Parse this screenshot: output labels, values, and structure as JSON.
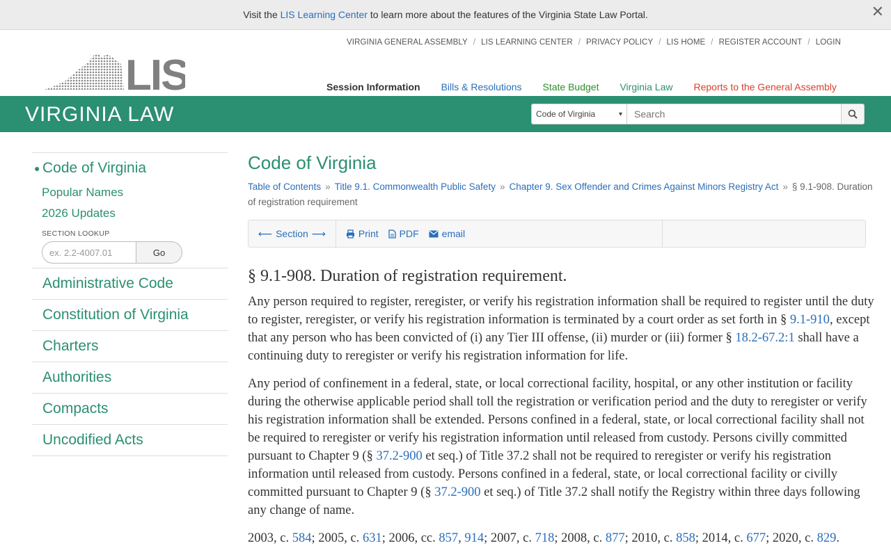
{
  "banner": {
    "prefix": "Visit the ",
    "link": "LIS Learning Center",
    "suffix": " to learn more about the features of the Virginia State Law Portal.",
    "close": "✕"
  },
  "topnav": [
    "VIRGINIA GENERAL ASSEMBLY",
    "LIS LEARNING CENTER",
    "PRIVACY POLICY",
    "LIS HOME",
    "REGISTER ACCOUNT",
    "LOGIN"
  ],
  "logo_text": "LIS",
  "mainnav": [
    {
      "label": "Session Information",
      "color": "#333333"
    },
    {
      "label": "Bills & Resolutions",
      "color": "#2a6ebb"
    },
    {
      "label": "State Budget",
      "color": "#2b8f2b"
    },
    {
      "label": "Virginia Law",
      "color": "#2b8f72"
    },
    {
      "label": "Reports to the General Assembly",
      "color": "#d9402b"
    }
  ],
  "section_banner": "VIRGINIA LAW",
  "search": {
    "scope": "Code of Virginia",
    "placeholder": "Search"
  },
  "sidebar": {
    "active": "Code of Virginia",
    "sub": [
      "Popular Names",
      "2026 Updates"
    ],
    "lookup_label": "SECTION LOOKUP",
    "lookup_placeholder": "ex. 2.2-4007.01",
    "go": "Go",
    "items": [
      "Administrative Code",
      "Constitution of Virginia",
      "Charters",
      "Authorities",
      "Compacts",
      "Uncodified Acts"
    ]
  },
  "content": {
    "title": "Code of Virginia",
    "crumbs": [
      "Table of Contents",
      "Title 9.1. Commonwealth Public Safety",
      "Chapter 9. Sex Offender and Crimes Against Minors Registry Act"
    ],
    "crumb_current": "§ 9.1-908. Duration of registration requirement",
    "toolbar": {
      "section": "Section",
      "print": "Print",
      "pdf": "PDF",
      "email": "email"
    },
    "section_title": "§ 9.1-908. Duration of registration requirement.",
    "p1": {
      "a": "Any person required to register, reregister, or verify his registration information shall be required to register until the duty to register, reregister, or verify his registration information is terminated by a court order as set forth in § ",
      "l1": "9.1-910",
      "b": ", except that any person who has been convicted of (i) any Tier III offense, (ii) murder or (iii) former § ",
      "l2": "18.2-67.2:1",
      "c": " shall have a continuing duty to reregister or verify his registration information for life."
    },
    "p2": {
      "a": "Any period of confinement in a federal, state, or local correctional facility, hospital, or any other institution or facility during the otherwise applicable period shall toll the registration or verification period and the duty to reregister or verify his registration information shall be extended. Persons confined in a federal, state, or local correctional facility shall not be required to reregister or verify his registration information until released from custody. Persons civilly committed pursuant to Chapter 9 (§ ",
      "l1": "37.2-900",
      "b": " et seq.) of Title 37.2 shall not be required to reregister or verify his registration information until released from custody. Persons confined in a federal, state, or local correctional facility or civilly committed pursuant to Chapter 9 (§ ",
      "l2": "37.2-900",
      "c": " et seq.) of Title 37.2 shall notify the Registry within three days following any change of name."
    },
    "history": [
      {
        "pre": "2003, c. ",
        "links": [
          "584"
        ]
      },
      {
        "pre": "2005, c. ",
        "links": [
          "631"
        ]
      },
      {
        "pre": "2006, cc. ",
        "links": [
          "857",
          "914"
        ]
      },
      {
        "pre": "2007, c. ",
        "links": [
          "718"
        ]
      },
      {
        "pre": "2008, c. ",
        "links": [
          "877"
        ]
      },
      {
        "pre": "2010, c. ",
        "links": [
          "858"
        ]
      },
      {
        "pre": "2014, c. ",
        "links": [
          "677"
        ]
      },
      {
        "pre": "2020, c. ",
        "links": [
          "829"
        ]
      }
    ]
  }
}
